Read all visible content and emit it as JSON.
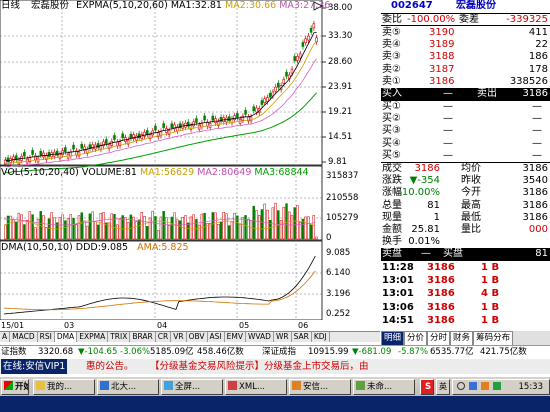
{
  "price_chart": {
    "period_label": "日线",
    "stock_name": "宏磊股份",
    "indicator": "EXPMA(5,10,20,60)",
    "ma1": "MA1:32.81",
    "ma2": "MA2:30.66",
    "ma3": "MA3:27.36",
    "price_axis": [
      "38.00",
      "33.30",
      "28.60",
      "23.91",
      "19.21",
      "14.51",
      "9.81"
    ],
    "colors": {
      "up": "#d00000",
      "down": "#008000",
      "ma1": "#000000",
      "ma2": "#d0a000",
      "ma3": "#d060c0",
      "ma4": "#00a000"
    }
  },
  "vol_chart": {
    "label": "VOL(5,10,20,40) VOLUME:81",
    "ma1": "MA1:56629",
    "ma2": "MA2:80649",
    "ma3": "MA3:68844",
    "axis": [
      "315837",
      "210558",
      "105279",
      "0"
    ]
  },
  "dma_chart": {
    "label": "DMA(10,50,10) DDD:9.085",
    "ama": "AMA:5.825",
    "axis": [
      "9.085",
      "6.140",
      "3.196",
      "0.252"
    ]
  },
  "date_axis": [
    "15/01",
    "03",
    "04",
    "05",
    "06"
  ],
  "indicator_tabs": [
    "A",
    "MACD",
    "RSI",
    "DMA",
    "EXPMA",
    "TRIX",
    "BRAR",
    "CR",
    "VR",
    "OBV",
    "ASI",
    "EMV",
    "WVAD",
    "WR",
    "SAR",
    "KDJ"
  ],
  "quote_panel": {
    "code": "002647",
    "name": "宏磊股份",
    "weibi_label": "委比",
    "weibi_value": "-100.00%",
    "weicha_label": "委差",
    "weicha_value": "-339325",
    "asks": [
      {
        "label": "卖⑤",
        "price": "3190",
        "vol": "411"
      },
      {
        "label": "卖④",
        "price": "3189",
        "vol": "22"
      },
      {
        "label": "卖③",
        "price": "3188",
        "vol": "186"
      },
      {
        "label": "卖②",
        "price": "3187",
        "vol": "178"
      },
      {
        "label": "卖①",
        "price": "3186",
        "vol": "338526"
      }
    ],
    "buy_row": {
      "label": "买入",
      "dash": "—",
      "sell_label": "卖出",
      "value": "3186"
    },
    "bids": [
      {
        "label": "买①",
        "price": "—",
        "vol": "—"
      },
      {
        "label": "买②",
        "price": "—",
        "vol": "—"
      },
      {
        "label": "买③",
        "price": "—",
        "vol": "—"
      },
      {
        "label": "买④",
        "price": "—",
        "vol": "—"
      },
      {
        "label": "买⑤",
        "price": "—",
        "vol": "—"
      }
    ],
    "stats": [
      {
        "l1": "成交",
        "v1": "3186",
        "l2": "均价",
        "v2": "3186"
      },
      {
        "l1": "涨跌",
        "v1": "▼-354",
        "l2": "昨收",
        "v2": "3540"
      },
      {
        "l1": "涨幅",
        "v1": "-10.00%",
        "l2": "今开",
        "v2": "3186"
      },
      {
        "l1": "总量",
        "v1": "81",
        "l2": "最高",
        "v2": "3186"
      },
      {
        "l1": "现量",
        "v1": "1",
        "l2": "最低",
        "v2": "3186"
      },
      {
        "l1": "金额",
        "v1": "25.81",
        "l2": "量比",
        "v2": "000"
      },
      {
        "l1": "换手",
        "v1": "0.01%",
        "l2": "",
        "v2": ""
      }
    ],
    "trade_header": {
      "sell": "卖盘",
      "dash": "—",
      "buy": "买盘",
      "value": "81"
    },
    "trades": [
      {
        "time": "11:28",
        "price": "3186",
        "vol": "1 B"
      },
      {
        "time": "13:01",
        "price": "3186",
        "vol": "1 B"
      },
      {
        "time": "13:01",
        "price": "3186",
        "vol": "4 B"
      },
      {
        "time": "13:06",
        "price": "3186",
        "vol": "1 B"
      },
      {
        "time": "14:51",
        "price": "3186",
        "vol": "1 B"
      }
    ],
    "bottom_tabs": [
      "明细",
      "分价",
      "分时",
      "财务",
      "筹码分布"
    ]
  },
  "status_bar": {
    "index1_label": "证指数",
    "index1_value": "3320.68",
    "index1_change": "▼-104.65",
    "index1_pct": "-3.06%",
    "index1_amount": "5185.09亿",
    "index1_amount2": "458.46亿数",
    "index2_label": "深证成指",
    "index2_value": "10915.99",
    "index2_change": "▼-681.09",
    "index2_pct": "-5.87%",
    "index2_amount": "6535.77亿",
    "index2_amount2": "421.75亿数"
  },
  "ticker": {
    "left": "在线:安信VIP1",
    "mid": "惠的公告。",
    "right": "【分级基金交易风险提示】分级基金上市交易后，由"
  },
  "taskbar": {
    "start": "开始",
    "items": [
      "我的...",
      "北大...",
      "全屏...",
      "XML...",
      "安信...",
      "未命..."
    ],
    "clock": "15:33"
  }
}
